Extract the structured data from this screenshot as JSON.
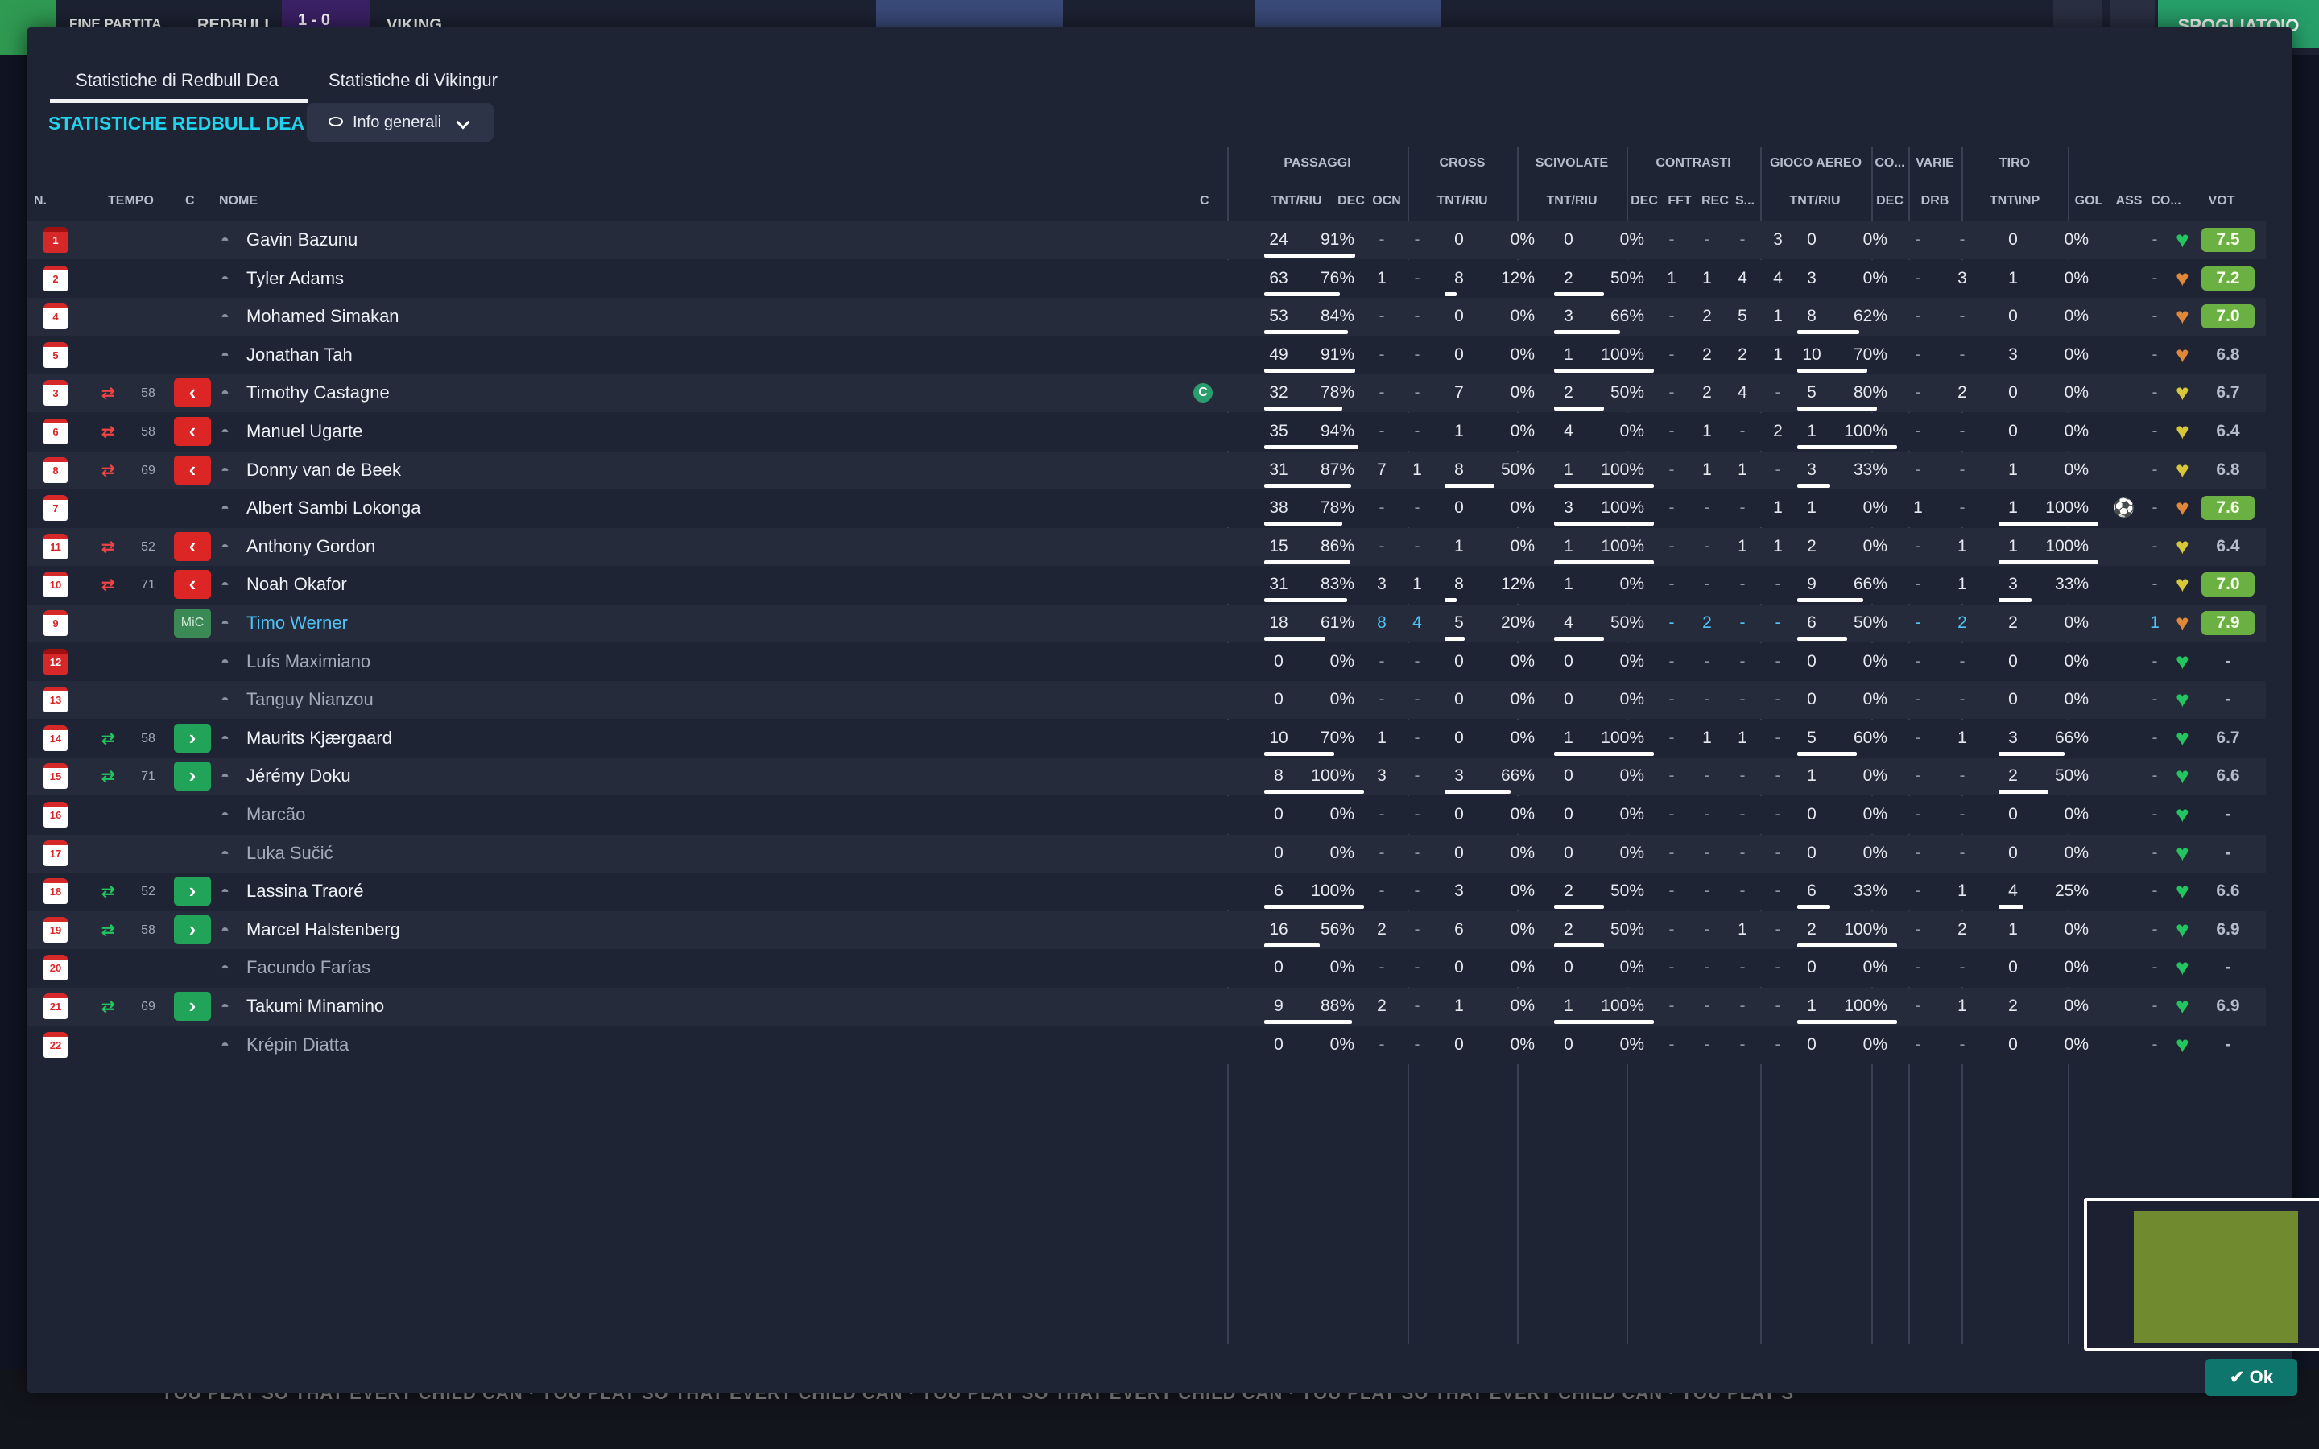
{
  "topbar": {
    "match_status": "FINE PARTITA",
    "home_short": "REDBULL",
    "score": "1 - 0",
    "away_short": "VIKING",
    "dressing_room_label": "SPOGLIATOIO"
  },
  "tabs": [
    {
      "label": "Statistiche di Redbull Dea",
      "active": true
    },
    {
      "label": "Statistiche di Vikingur",
      "active": false
    }
  ],
  "section_title": "STATISTICHE REDBULL DEA",
  "view_dropdown": {
    "label": "Info generali",
    "icon": "eye-icon"
  },
  "group_headers": {
    "passaggi": "PASSAGGI",
    "cross": "CROSS",
    "scivolate": "SCIVOLATE",
    "contrasti": "CONTRASTI",
    "gioco_aereo": "GIOCO AEREO",
    "co": "CO...",
    "varie": "VARIE",
    "tiro": "TIRO"
  },
  "column_headers": {
    "n": "N.",
    "tempo": "TEMPO",
    "c": "C",
    "nome": "NOME",
    "c2": "C",
    "pass_tnt_riu": "TNT/RIU",
    "pass_dec": "DEC",
    "pass_ocn": "OCN",
    "cross_tnt_riu": "TNT/RIU",
    "sciv_tnt_riu": "TNT/RIU",
    "contr_dec": "DEC",
    "contr_fft": "FFT",
    "contr_rec": "REC",
    "contr_s": "S...",
    "aereo_tnt_riu": "TNT/RIU",
    "co_dec": "DEC",
    "varie_drb": "DRB",
    "tiro_tnt_inp": "TNT\\INP",
    "gol": "GOL",
    "ass": "ASS",
    "co": "CO...",
    "vot": "VOT"
  },
  "players": [
    {
      "n": "1",
      "gk": true,
      "sub": "",
      "minute": "",
      "name": "Gavin Bazunu",
      "played": true,
      "p_tnt": "24",
      "p_pct": "91%",
      "p_frac": 0.91,
      "p_dec": "-",
      "p_ocn": "-",
      "c_tnt": "0",
      "c_pct": "0%",
      "c_frac": 0,
      "s_tnt": "0",
      "s_pct": "0%",
      "s_frac": 0,
      "ct_dec": "-",
      "ct_fft": "-",
      "ct_rec": "-",
      "ct_s": "3",
      "a_tnt": "0",
      "a_pct": "0%",
      "a_frac": 0,
      "co_dec": "-",
      "v_drb": "-",
      "t_tnt": "0",
      "t_pct": "0%",
      "t_frac": 0,
      "gol": "",
      "ass": "-",
      "heart": "green",
      "vot": "7.5",
      "vot_hi": true
    },
    {
      "n": "2",
      "gk": false,
      "sub": "",
      "minute": "",
      "name": "Tyler Adams",
      "played": true,
      "p_tnt": "63",
      "p_pct": "76%",
      "p_frac": 0.76,
      "p_dec": "1",
      "p_ocn": "-",
      "c_tnt": "8",
      "c_pct": "12%",
      "c_frac": 0.12,
      "s_tnt": "2",
      "s_pct": "50%",
      "s_frac": 0.5,
      "ct_dec": "1",
      "ct_fft": "1",
      "ct_rec": "4",
      "ct_s": "4",
      "a_tnt": "3",
      "a_pct": "0%",
      "a_frac": 0,
      "co_dec": "-",
      "v_drb": "3",
      "t_tnt": "1",
      "t_pct": "0%",
      "t_frac": 0,
      "gol": "",
      "ass": "-",
      "heart": "orange",
      "vot": "7.2",
      "vot_hi": true
    },
    {
      "n": "4",
      "gk": false,
      "sub": "",
      "minute": "",
      "name": "Mohamed Simakan",
      "played": true,
      "p_tnt": "53",
      "p_pct": "84%",
      "p_frac": 0.84,
      "p_dec": "-",
      "p_ocn": "-",
      "c_tnt": "0",
      "c_pct": "0%",
      "c_frac": 0,
      "s_tnt": "3",
      "s_pct": "66%",
      "s_frac": 0.66,
      "ct_dec": "-",
      "ct_fft": "2",
      "ct_rec": "5",
      "ct_s": "1",
      "a_tnt": "8",
      "a_pct": "62%",
      "a_frac": 0.62,
      "co_dec": "-",
      "v_drb": "-",
      "t_tnt": "0",
      "t_pct": "0%",
      "t_frac": 0,
      "gol": "",
      "ass": "-",
      "heart": "orange",
      "vot": "7.0",
      "vot_hi": true
    },
    {
      "n": "5",
      "gk": false,
      "sub": "",
      "minute": "",
      "name": "Jonathan Tah",
      "played": true,
      "p_tnt": "49",
      "p_pct": "91%",
      "p_frac": 0.91,
      "p_dec": "-",
      "p_ocn": "-",
      "c_tnt": "0",
      "c_pct": "0%",
      "c_frac": 0,
      "s_tnt": "1",
      "s_pct": "100%",
      "s_frac": 1,
      "ct_dec": "-",
      "ct_fft": "2",
      "ct_rec": "2",
      "ct_s": "1",
      "a_tnt": "10",
      "a_pct": "70%",
      "a_frac": 0.7,
      "co_dec": "-",
      "v_drb": "-",
      "t_tnt": "3",
      "t_pct": "0%",
      "t_frac": 0,
      "gol": "",
      "ass": "-",
      "heart": "orange",
      "vot": "6.8",
      "vot_hi": false
    },
    {
      "n": "3",
      "gk": false,
      "sub": "out",
      "minute": "58",
      "name": "Timothy Castagne",
      "played": true,
      "captain": "C",
      "p_tnt": "32",
      "p_pct": "78%",
      "p_frac": 0.78,
      "p_dec": "-",
      "p_ocn": "-",
      "c_tnt": "7",
      "c_pct": "0%",
      "c_frac": 0,
      "s_tnt": "2",
      "s_pct": "50%",
      "s_frac": 0.5,
      "ct_dec": "-",
      "ct_fft": "2",
      "ct_rec": "4",
      "ct_s": "-",
      "a_tnt": "5",
      "a_pct": "80%",
      "a_frac": 0.8,
      "co_dec": "-",
      "v_drb": "2",
      "t_tnt": "0",
      "t_pct": "0%",
      "t_frac": 0,
      "gol": "",
      "ass": "-",
      "heart": "yellow",
      "vot": "6.7",
      "vot_hi": false
    },
    {
      "n": "6",
      "gk": false,
      "sub": "out",
      "minute": "58",
      "name": "Manuel Ugarte",
      "played": true,
      "p_tnt": "35",
      "p_pct": "94%",
      "p_frac": 0.94,
      "p_dec": "-",
      "p_ocn": "-",
      "c_tnt": "1",
      "c_pct": "0%",
      "c_frac": 0,
      "s_tnt": "4",
      "s_pct": "0%",
      "s_frac": 0,
      "ct_dec": "-",
      "ct_fft": "1",
      "ct_rec": "-",
      "ct_s": "2",
      "a_tnt": "1",
      "a_pct": "100%",
      "a_frac": 1,
      "co_dec": "-",
      "v_drb": "-",
      "t_tnt": "0",
      "t_pct": "0%",
      "t_frac": 0,
      "gol": "",
      "ass": "-",
      "heart": "yellow",
      "vot": "6.4",
      "vot_hi": false
    },
    {
      "n": "8",
      "gk": false,
      "sub": "out",
      "minute": "69",
      "name": "Donny van de Beek",
      "played": true,
      "p_tnt": "31",
      "p_pct": "87%",
      "p_frac": 0.87,
      "p_dec": "7",
      "p_ocn": "1",
      "c_tnt": "8",
      "c_pct": "50%",
      "c_frac": 0.5,
      "s_tnt": "1",
      "s_pct": "100%",
      "s_frac": 1,
      "ct_dec": "-",
      "ct_fft": "1",
      "ct_rec": "1",
      "ct_s": "-",
      "a_tnt": "3",
      "a_pct": "33%",
      "a_frac": 0.33,
      "co_dec": "-",
      "v_drb": "-",
      "t_tnt": "1",
      "t_pct": "0%",
      "t_frac": 0,
      "gol": "",
      "ass": "-",
      "heart": "yellow",
      "vot": "6.8",
      "vot_hi": false
    },
    {
      "n": "7",
      "gk": false,
      "sub": "",
      "minute": "",
      "name": "Albert Sambi Lokonga",
      "played": true,
      "p_tnt": "38",
      "p_pct": "78%",
      "p_frac": 0.78,
      "p_dec": "-",
      "p_ocn": "-",
      "c_tnt": "0",
      "c_pct": "0%",
      "c_frac": 0,
      "s_tnt": "3",
      "s_pct": "100%",
      "s_frac": 1,
      "ct_dec": "-",
      "ct_fft": "-",
      "ct_rec": "-",
      "ct_s": "1",
      "a_tnt": "1",
      "a_pct": "0%",
      "a_frac": 0,
      "co_dec": "1",
      "v_drb": "-",
      "t_tnt": "1",
      "t_pct": "100%",
      "t_frac": 1,
      "gol": "ball",
      "ass": "-",
      "heart": "orange",
      "vot": "7.6",
      "vot_hi": true
    },
    {
      "n": "11",
      "gk": false,
      "sub": "out",
      "minute": "52",
      "name": "Anthony Gordon",
      "played": true,
      "p_tnt": "15",
      "p_pct": "86%",
      "p_frac": 0.86,
      "p_dec": "-",
      "p_ocn": "-",
      "c_tnt": "1",
      "c_pct": "0%",
      "c_frac": 0,
      "s_tnt": "1",
      "s_pct": "100%",
      "s_frac": 1,
      "ct_dec": "-",
      "ct_fft": "-",
      "ct_rec": "1",
      "ct_s": "1",
      "a_tnt": "2",
      "a_pct": "0%",
      "a_frac": 0,
      "co_dec": "-",
      "v_drb": "1",
      "t_tnt": "1",
      "t_pct": "100%",
      "t_frac": 1,
      "gol": "",
      "ass": "-",
      "heart": "yellow",
      "vot": "6.4",
      "vot_hi": false
    },
    {
      "n": "10",
      "gk": false,
      "sub": "out",
      "minute": "71",
      "name": "Noah Okafor",
      "played": true,
      "p_tnt": "31",
      "p_pct": "83%",
      "p_frac": 0.83,
      "p_dec": "3",
      "p_ocn": "1",
      "c_tnt": "8",
      "c_pct": "12%",
      "c_frac": 0.12,
      "s_tnt": "1",
      "s_pct": "0%",
      "s_frac": 0,
      "ct_dec": "-",
      "ct_fft": "-",
      "ct_rec": "-",
      "ct_s": "-",
      "a_tnt": "9",
      "a_pct": "66%",
      "a_frac": 0.66,
      "co_dec": "-",
      "v_drb": "1",
      "t_tnt": "3",
      "t_pct": "33%",
      "t_frac": 0.33,
      "gol": "",
      "ass": "-",
      "heart": "yellow",
      "vot": "7.0",
      "vot_hi": true
    },
    {
      "n": "9",
      "gk": false,
      "sub": "mic",
      "minute": "",
      "mic_label": "MiC",
      "name": "Timo Werner",
      "played": true,
      "highlight": true,
      "p_tnt": "18",
      "p_pct": "61%",
      "p_frac": 0.61,
      "p_dec": "8",
      "p_ocn": "4",
      "c_tnt": "5",
      "c_pct": "20%",
      "c_frac": 0.2,
      "s_tnt": "4",
      "s_pct": "50%",
      "s_frac": 0.5,
      "ct_dec": "-",
      "ct_fft": "2",
      "ct_rec": "-",
      "ct_s": "-",
      "a_tnt": "6",
      "a_pct": "50%",
      "a_frac": 0.5,
      "co_dec": "-",
      "v_drb": "2",
      "t_tnt": "2",
      "t_pct": "0%",
      "t_frac": 0,
      "gol": "",
      "ass": "1",
      "heart": "orange",
      "vot": "7.9",
      "vot_hi": true
    },
    {
      "n": "12",
      "gk": true,
      "sub": "",
      "minute": "",
      "name": "Luís Maximiano",
      "played": false,
      "p_tnt": "0",
      "p_pct": "0%",
      "p_frac": 0,
      "p_dec": "-",
      "p_ocn": "-",
      "c_tnt": "0",
      "c_pct": "0%",
      "c_frac": 0,
      "s_tnt": "0",
      "s_pct": "0%",
      "s_frac": 0,
      "ct_dec": "-",
      "ct_fft": "-",
      "ct_rec": "-",
      "ct_s": "-",
      "a_tnt": "0",
      "a_pct": "0%",
      "a_frac": 0,
      "co_dec": "-",
      "v_drb": "-",
      "t_tnt": "0",
      "t_pct": "0%",
      "t_frac": 0,
      "gol": "",
      "ass": "-",
      "heart": "green",
      "vot": "-",
      "vot_hi": false
    },
    {
      "n": "13",
      "gk": false,
      "sub": "",
      "minute": "",
      "name": "Tanguy Nianzou",
      "played": false,
      "p_tnt": "0",
      "p_pct": "0%",
      "p_frac": 0,
      "p_dec": "-",
      "p_ocn": "-",
      "c_tnt": "0",
      "c_pct": "0%",
      "c_frac": 0,
      "s_tnt": "0",
      "s_pct": "0%",
      "s_frac": 0,
      "ct_dec": "-",
      "ct_fft": "-",
      "ct_rec": "-",
      "ct_s": "-",
      "a_tnt": "0",
      "a_pct": "0%",
      "a_frac": 0,
      "co_dec": "-",
      "v_drb": "-",
      "t_tnt": "0",
      "t_pct": "0%",
      "t_frac": 0,
      "gol": "",
      "ass": "-",
      "heart": "green",
      "vot": "-",
      "vot_hi": false
    },
    {
      "n": "14",
      "gk": false,
      "sub": "in",
      "minute": "58",
      "name": "Maurits Kjærgaard",
      "played": true,
      "p_tnt": "10",
      "p_pct": "70%",
      "p_frac": 0.7,
      "p_dec": "1",
      "p_ocn": "-",
      "c_tnt": "0",
      "c_pct": "0%",
      "c_frac": 0,
      "s_tnt": "1",
      "s_pct": "100%",
      "s_frac": 1,
      "ct_dec": "-",
      "ct_fft": "1",
      "ct_rec": "1",
      "ct_s": "-",
      "a_tnt": "5",
      "a_pct": "60%",
      "a_frac": 0.6,
      "co_dec": "-",
      "v_drb": "1",
      "t_tnt": "3",
      "t_pct": "66%",
      "t_frac": 0.66,
      "gol": "",
      "ass": "-",
      "heart": "green",
      "vot": "6.7",
      "vot_hi": false
    },
    {
      "n": "15",
      "gk": false,
      "sub": "in",
      "minute": "71",
      "name": "Jérémy Doku",
      "played": true,
      "p_tnt": "8",
      "p_pct": "100%",
      "p_frac": 1,
      "p_dec": "3",
      "p_ocn": "-",
      "c_tnt": "3",
      "c_pct": "66%",
      "c_frac": 0.66,
      "s_tnt": "0",
      "s_pct": "0%",
      "s_frac": 0,
      "ct_dec": "-",
      "ct_fft": "-",
      "ct_rec": "-",
      "ct_s": "-",
      "a_tnt": "1",
      "a_pct": "0%",
      "a_frac": 0,
      "co_dec": "-",
      "v_drb": "-",
      "t_tnt": "2",
      "t_pct": "50%",
      "t_frac": 0.5,
      "gol": "",
      "ass": "-",
      "heart": "green",
      "vot": "6.6",
      "vot_hi": false
    },
    {
      "n": "16",
      "gk": false,
      "sub": "",
      "minute": "",
      "name": "Marcão",
      "played": false,
      "p_tnt": "0",
      "p_pct": "0%",
      "p_frac": 0,
      "p_dec": "-",
      "p_ocn": "-",
      "c_tnt": "0",
      "c_pct": "0%",
      "c_frac": 0,
      "s_tnt": "0",
      "s_pct": "0%",
      "s_frac": 0,
      "ct_dec": "-",
      "ct_fft": "-",
      "ct_rec": "-",
      "ct_s": "-",
      "a_tnt": "0",
      "a_pct": "0%",
      "a_frac": 0,
      "co_dec": "-",
      "v_drb": "-",
      "t_tnt": "0",
      "t_pct": "0%",
      "t_frac": 0,
      "gol": "",
      "ass": "-",
      "heart": "green",
      "vot": "-",
      "vot_hi": false
    },
    {
      "n": "17",
      "gk": false,
      "sub": "",
      "minute": "",
      "name": "Luka Sučić",
      "played": false,
      "p_tnt": "0",
      "p_pct": "0%",
      "p_frac": 0,
      "p_dec": "-",
      "p_ocn": "-",
      "c_tnt": "0",
      "c_pct": "0%",
      "c_frac": 0,
      "s_tnt": "0",
      "s_pct": "0%",
      "s_frac": 0,
      "ct_dec": "-",
      "ct_fft": "-",
      "ct_rec": "-",
      "ct_s": "-",
      "a_tnt": "0",
      "a_pct": "0%",
      "a_frac": 0,
      "co_dec": "-",
      "v_drb": "-",
      "t_tnt": "0",
      "t_pct": "0%",
      "t_frac": 0,
      "gol": "",
      "ass": "-",
      "heart": "green",
      "vot": "-",
      "vot_hi": false
    },
    {
      "n": "18",
      "gk": false,
      "sub": "in",
      "minute": "52",
      "name": "Lassina Traoré",
      "played": true,
      "p_tnt": "6",
      "p_pct": "100%",
      "p_frac": 1,
      "p_dec": "-",
      "p_ocn": "-",
      "c_tnt": "3",
      "c_pct": "0%",
      "c_frac": 0,
      "s_tnt": "2",
      "s_pct": "50%",
      "s_frac": 0.5,
      "ct_dec": "-",
      "ct_fft": "-",
      "ct_rec": "-",
      "ct_s": "-",
      "a_tnt": "6",
      "a_pct": "33%",
      "a_frac": 0.33,
      "co_dec": "-",
      "v_drb": "1",
      "t_tnt": "4",
      "t_pct": "25%",
      "t_frac": 0.25,
      "gol": "",
      "ass": "-",
      "heart": "green",
      "vot": "6.6",
      "vot_hi": false
    },
    {
      "n": "19",
      "gk": false,
      "sub": "in",
      "minute": "58",
      "name": "Marcel Halstenberg",
      "played": true,
      "p_tnt": "16",
      "p_pct": "56%",
      "p_frac": 0.56,
      "p_dec": "2",
      "p_ocn": "-",
      "c_tnt": "6",
      "c_pct": "0%",
      "c_frac": 0,
      "s_tnt": "2",
      "s_pct": "50%",
      "s_frac": 0.5,
      "ct_dec": "-",
      "ct_fft": "-",
      "ct_rec": "1",
      "ct_s": "-",
      "a_tnt": "2",
      "a_pct": "100%",
      "a_frac": 1,
      "co_dec": "-",
      "v_drb": "2",
      "t_tnt": "1",
      "t_pct": "0%",
      "t_frac": 0,
      "gol": "",
      "ass": "-",
      "heart": "green",
      "vot": "6.9",
      "vot_hi": false
    },
    {
      "n": "20",
      "gk": false,
      "sub": "",
      "minute": "",
      "name": "Facundo Farías",
      "played": false,
      "p_tnt": "0",
      "p_pct": "0%",
      "p_frac": 0,
      "p_dec": "-",
      "p_ocn": "-",
      "c_tnt": "0",
      "c_pct": "0%",
      "c_frac": 0,
      "s_tnt": "0",
      "s_pct": "0%",
      "s_frac": 0,
      "ct_dec": "-",
      "ct_fft": "-",
      "ct_rec": "-",
      "ct_s": "-",
      "a_tnt": "0",
      "a_pct": "0%",
      "a_frac": 0,
      "co_dec": "-",
      "v_drb": "-",
      "t_tnt": "0",
      "t_pct": "0%",
      "t_frac": 0,
      "gol": "",
      "ass": "-",
      "heart": "green",
      "vot": "-",
      "vot_hi": false
    },
    {
      "n": "21",
      "gk": false,
      "sub": "in",
      "minute": "69",
      "name": "Takumi Minamino",
      "played": true,
      "p_tnt": "9",
      "p_pct": "88%",
      "p_frac": 0.88,
      "p_dec": "2",
      "p_ocn": "-",
      "c_tnt": "1",
      "c_pct": "0%",
      "c_frac": 0,
      "s_tnt": "1",
      "s_pct": "100%",
      "s_frac": 1,
      "ct_dec": "-",
      "ct_fft": "-",
      "ct_rec": "-",
      "ct_s": "-",
      "a_tnt": "1",
      "a_pct": "100%",
      "a_frac": 1,
      "co_dec": "-",
      "v_drb": "1",
      "t_tnt": "2",
      "t_pct": "0%",
      "t_frac": 0,
      "gol": "",
      "ass": "-",
      "heart": "green",
      "vot": "6.9",
      "vot_hi": false
    },
    {
      "n": "22",
      "gk": false,
      "sub": "",
      "minute": "",
      "name": "Krépin Diatta",
      "played": false,
      "p_tnt": "0",
      "p_pct": "0%",
      "p_frac": 0,
      "p_dec": "-",
      "p_ocn": "-",
      "c_tnt": "0",
      "c_pct": "0%",
      "c_frac": 0,
      "s_tnt": "0",
      "s_pct": "0%",
      "s_frac": 0,
      "ct_dec": "-",
      "ct_fft": "-",
      "ct_rec": "-",
      "ct_s": "-",
      "a_tnt": "0",
      "a_pct": "0%",
      "a_frac": 0,
      "co_dec": "-",
      "v_drb": "-",
      "t_tnt": "0",
      "t_pct": "0%",
      "t_frac": 0,
      "gol": "",
      "ass": "-",
      "heart": "green",
      "vot": "-",
      "vot_hi": false
    }
  ],
  "colors": {
    "accent_cyan": "#22d3ee",
    "rating_good": "#6bb043",
    "heart_green": "#22c55e",
    "heart_orange": "#e0883a",
    "heart_yellow": "#d7c83a",
    "sub_out": "#dc2626",
    "sub_in": "#22a35a",
    "ok_button": "#0f766e"
  },
  "ok_button": {
    "label": "Ok",
    "icon": "check-icon"
  },
  "ticker": {
    "text": "YOU PLAY SO THAT EVERY CHILD CAN · YOU PLAY SO THAT EVERY CHILD CAN · YOU PLAY SO THAT EVERY CHILD CAN · YOU PLAY SO THAT EVERY CHILD CAN · YOU PLAY S"
  }
}
